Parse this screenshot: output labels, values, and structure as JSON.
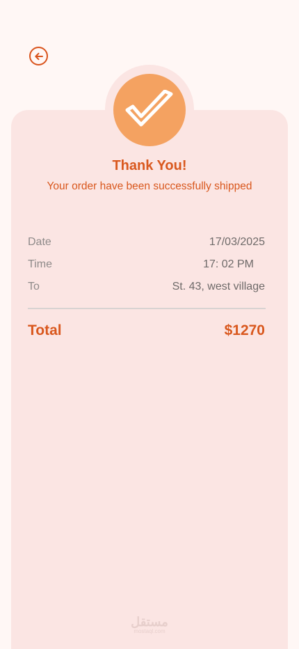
{
  "header": {
    "back_icon": "arrow-left-circle-icon"
  },
  "success": {
    "icon": "checkmark-icon",
    "title": "Thank You!",
    "message": "Your order have been successfully shipped"
  },
  "details": [
    {
      "label": "Date",
      "value": "17/03/2025"
    },
    {
      "label": "Time",
      "value": "17: 02 PM"
    },
    {
      "label": "To",
      "value": "St. 43, west village"
    }
  ],
  "total": {
    "label": "Total",
    "value": "$1270"
  },
  "watermark": {
    "main": "مستقل",
    "sub": "mostaql.com"
  },
  "colors": {
    "accent": "#D9581E",
    "badge": "#F4A261",
    "card": "#FBE5E3",
    "background": "#FFF7F5"
  }
}
